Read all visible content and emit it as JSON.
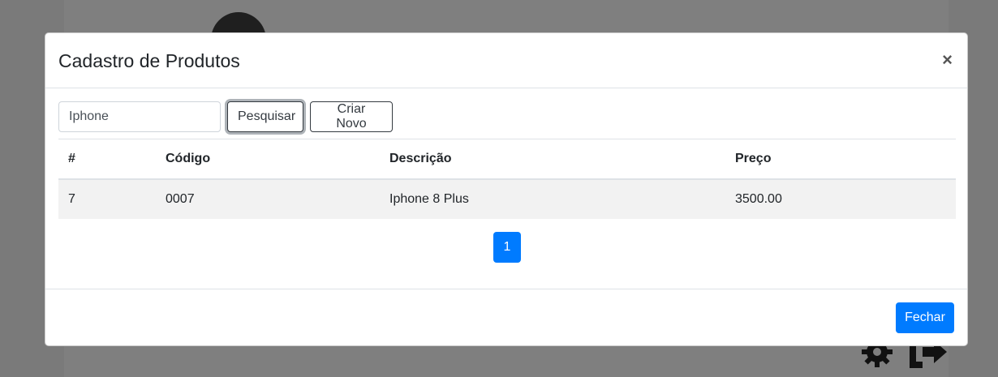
{
  "modal": {
    "title": "Cadastro de Produtos",
    "close_label": "×"
  },
  "search": {
    "value": "Iphone",
    "search_button": "Pesquisar",
    "new_button": "Criar Novo"
  },
  "table": {
    "headers": [
      "#",
      "Código",
      "Descrição",
      "Preço"
    ],
    "rows": [
      [
        "7",
        "0007",
        "Iphone 8 Plus",
        "3500.00"
      ]
    ]
  },
  "pagination": {
    "current_page": "1"
  },
  "footer": {
    "close_button": "Fechar"
  },
  "colors": {
    "primary": "#007bff",
    "striped_row": "#f2f2f2",
    "backdrop": "#7a7a7a"
  },
  "background_icons": [
    "gear-icon",
    "sign-out-icon"
  ]
}
